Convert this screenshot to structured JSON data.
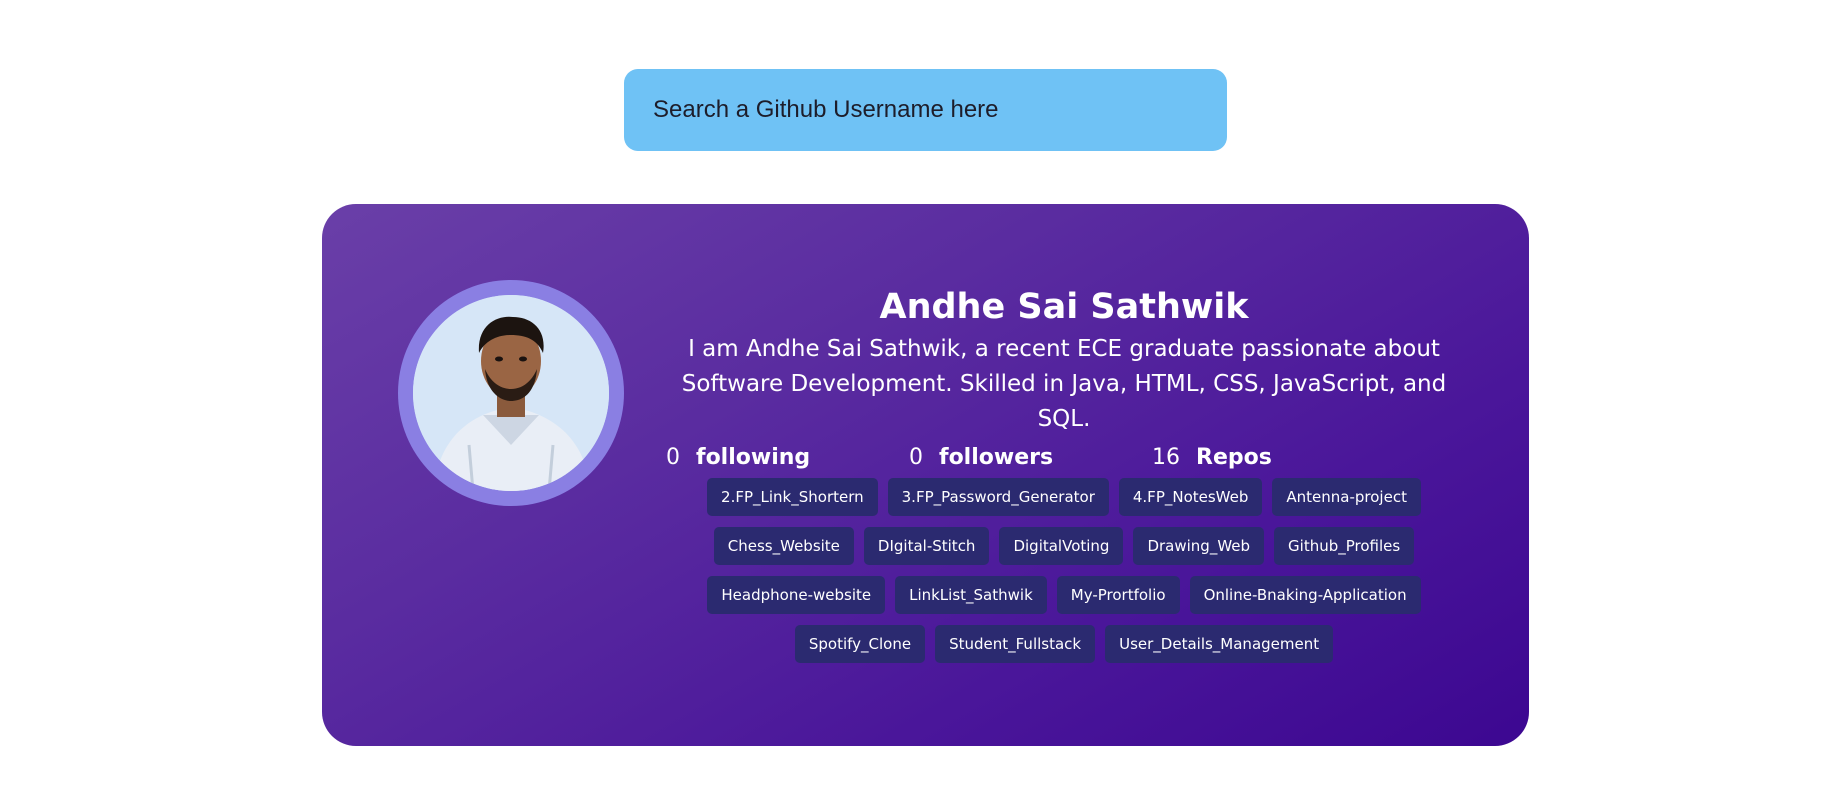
{
  "search": {
    "placeholder": "Search a Github Username here"
  },
  "profile": {
    "name": "Andhe Sai Sathwik",
    "bio": "I am Andhe Sai Sathwik, a recent ECE graduate passionate about Software Development. Skilled in Java, HTML, CSS, JavaScript, and SQL.",
    "stats": {
      "following": {
        "value": "0",
        "label": "following"
      },
      "followers": {
        "value": "0",
        "label": "followers"
      },
      "repos": {
        "value": "16",
        "label": "Repos"
      }
    },
    "repos": [
      "2.FP_Link_Shortern",
      "3.FP_Password_Generator",
      "4.FP_NotesWeb",
      "Antenna-project",
      "Chess_Website",
      "DIgital-Stitch",
      "DigitalVoting",
      "Drawing_Web",
      "Github_Profiles",
      "Headphone-website",
      "LinkList_Sathwik",
      "My-Prortfolio",
      "Online-Bnaking-Application",
      "Spotify_Clone",
      "Student_Fullstack",
      "User_Details_Management"
    ]
  },
  "colors": {
    "search_bg": "#6fc2f5",
    "card_gradient_start": "#6a3fa8",
    "card_gradient_end": "#3c0791",
    "avatar_ring": "#8a7fe3",
    "repo_chip": "#2b2a70"
  }
}
